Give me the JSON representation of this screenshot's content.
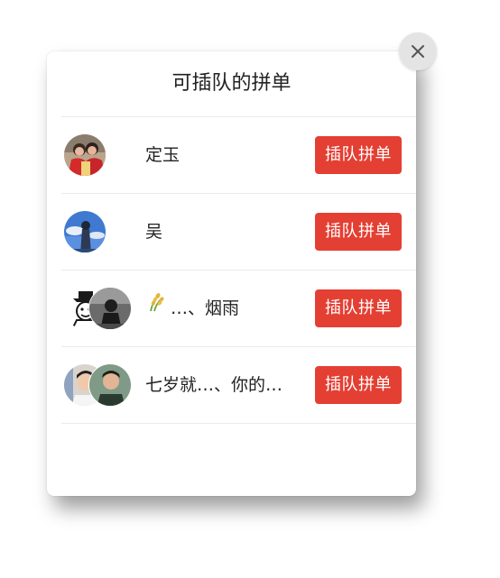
{
  "dialog": {
    "title": "可插队的拼单",
    "close_icon": "close-icon"
  },
  "rows": [
    {
      "name": "定玉",
      "button_label": "插队拼单",
      "avatars": [
        "avatar-photo-two-women"
      ]
    },
    {
      "name": "吴",
      "button_label": "插队拼单",
      "avatars": [
        "avatar-photo-sky"
      ]
    },
    {
      "name": "…、烟雨",
      "button_label": "插队拼单",
      "avatars": [
        "avatar-cartoon-figure",
        "avatar-photo-dark"
      ],
      "name_icon": "wheat-icon"
    },
    {
      "name": "七岁就…、你的…",
      "button_label": "插队拼单",
      "avatars": [
        "avatar-photo-boy",
        "avatar-photo-man"
      ]
    }
  ],
  "colors": {
    "button_bg": "#e43f33",
    "button_text": "#ffffff",
    "title_text": "#222222",
    "close_bg": "#e4e4e4",
    "divider": "#ebebeb"
  }
}
